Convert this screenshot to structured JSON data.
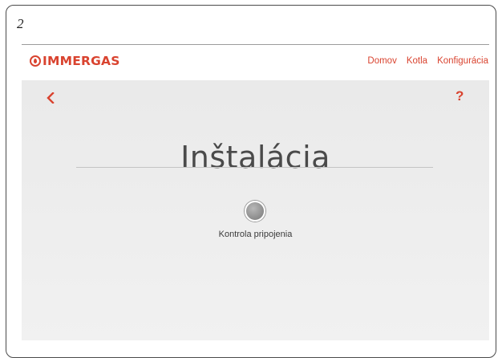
{
  "figure_number": "2",
  "brand": {
    "logo_text": "IMMERGAS",
    "accent_color": "#d9432f"
  },
  "nav": {
    "items": [
      {
        "label": "Domov"
      },
      {
        "label": "Kotla"
      },
      {
        "label": "Konfigurácia"
      }
    ],
    "active_item": "Konfigurácia"
  },
  "toolbar": {
    "back_icon": "chevron-left-icon",
    "help_label": "?"
  },
  "main": {
    "title": "Inštalácia",
    "status_indicator_state": "inactive",
    "status_label": "Kontrola pripojenia"
  }
}
